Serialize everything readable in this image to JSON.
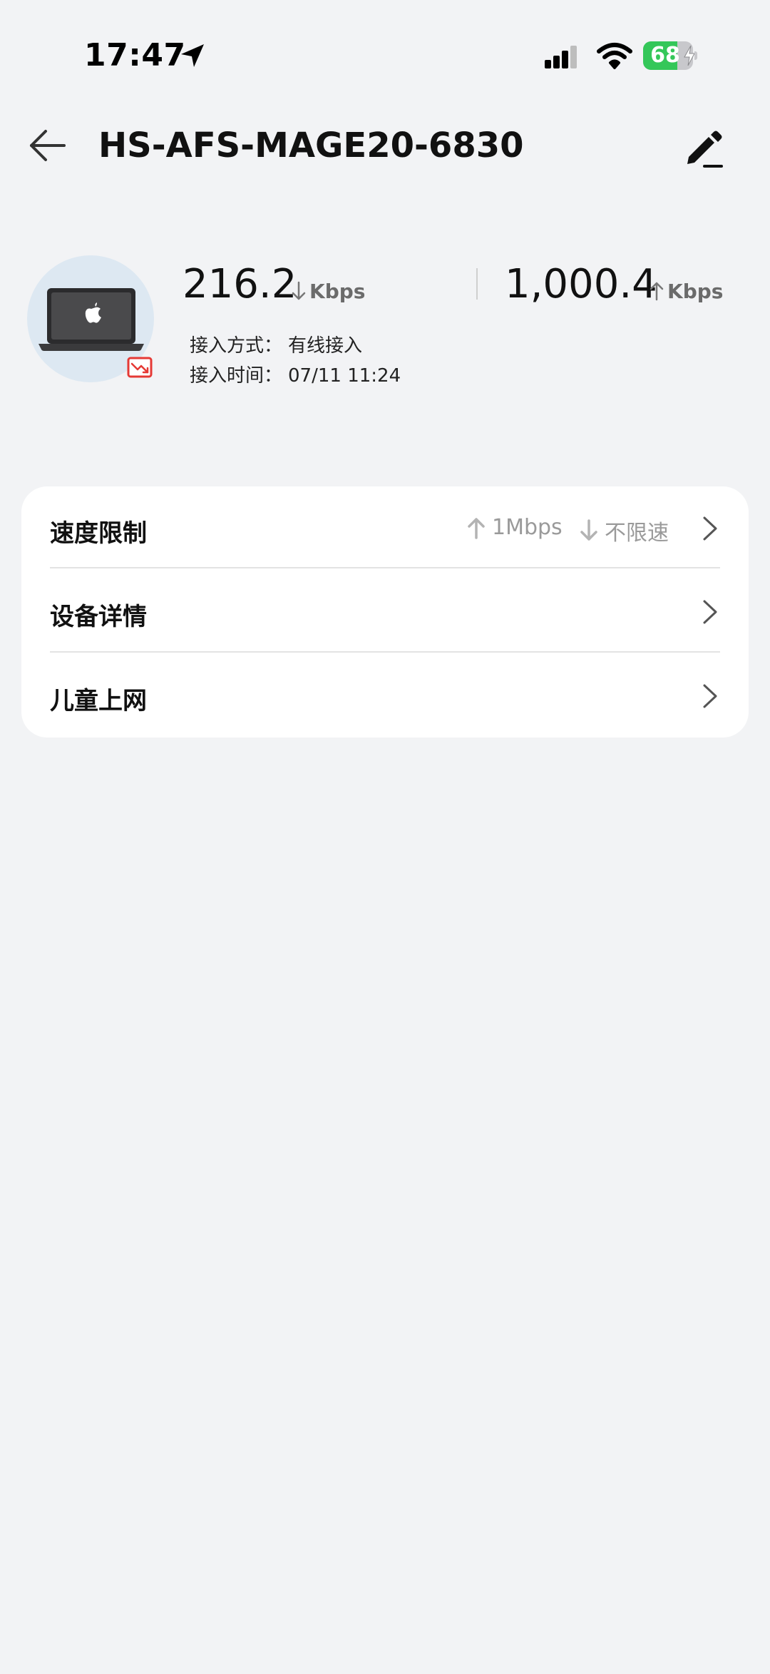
{
  "status_bar": {
    "time": "17:47",
    "battery_level": 68,
    "battery_label": "68",
    "charging": true,
    "battery_color": "#34c759"
  },
  "header": {
    "title": "HS-AFS-MAGE20-6830",
    "back_icon": "arrow-left-icon",
    "edit_icon": "pencil-icon"
  },
  "device": {
    "icon": "laptop-icon",
    "badge_icon": "limited-trend-icon",
    "badge_color": "#e53935",
    "download_speed": "216.2",
    "download_unit": "Kbps",
    "upload_speed": "1,000.4",
    "upload_unit": "Kbps",
    "access_method_label": "接入方式：",
    "access_method_value": "有线接入",
    "access_time_label": "接入时间：",
    "access_time_value": "07/11 11:24"
  },
  "settings": {
    "speed_limit": {
      "label": "速度限制",
      "upload_limit": "1Mbps",
      "download_limit": "不限速"
    },
    "device_details": {
      "label": "设备详情"
    },
    "child_internet": {
      "label": "儿童上网"
    }
  }
}
